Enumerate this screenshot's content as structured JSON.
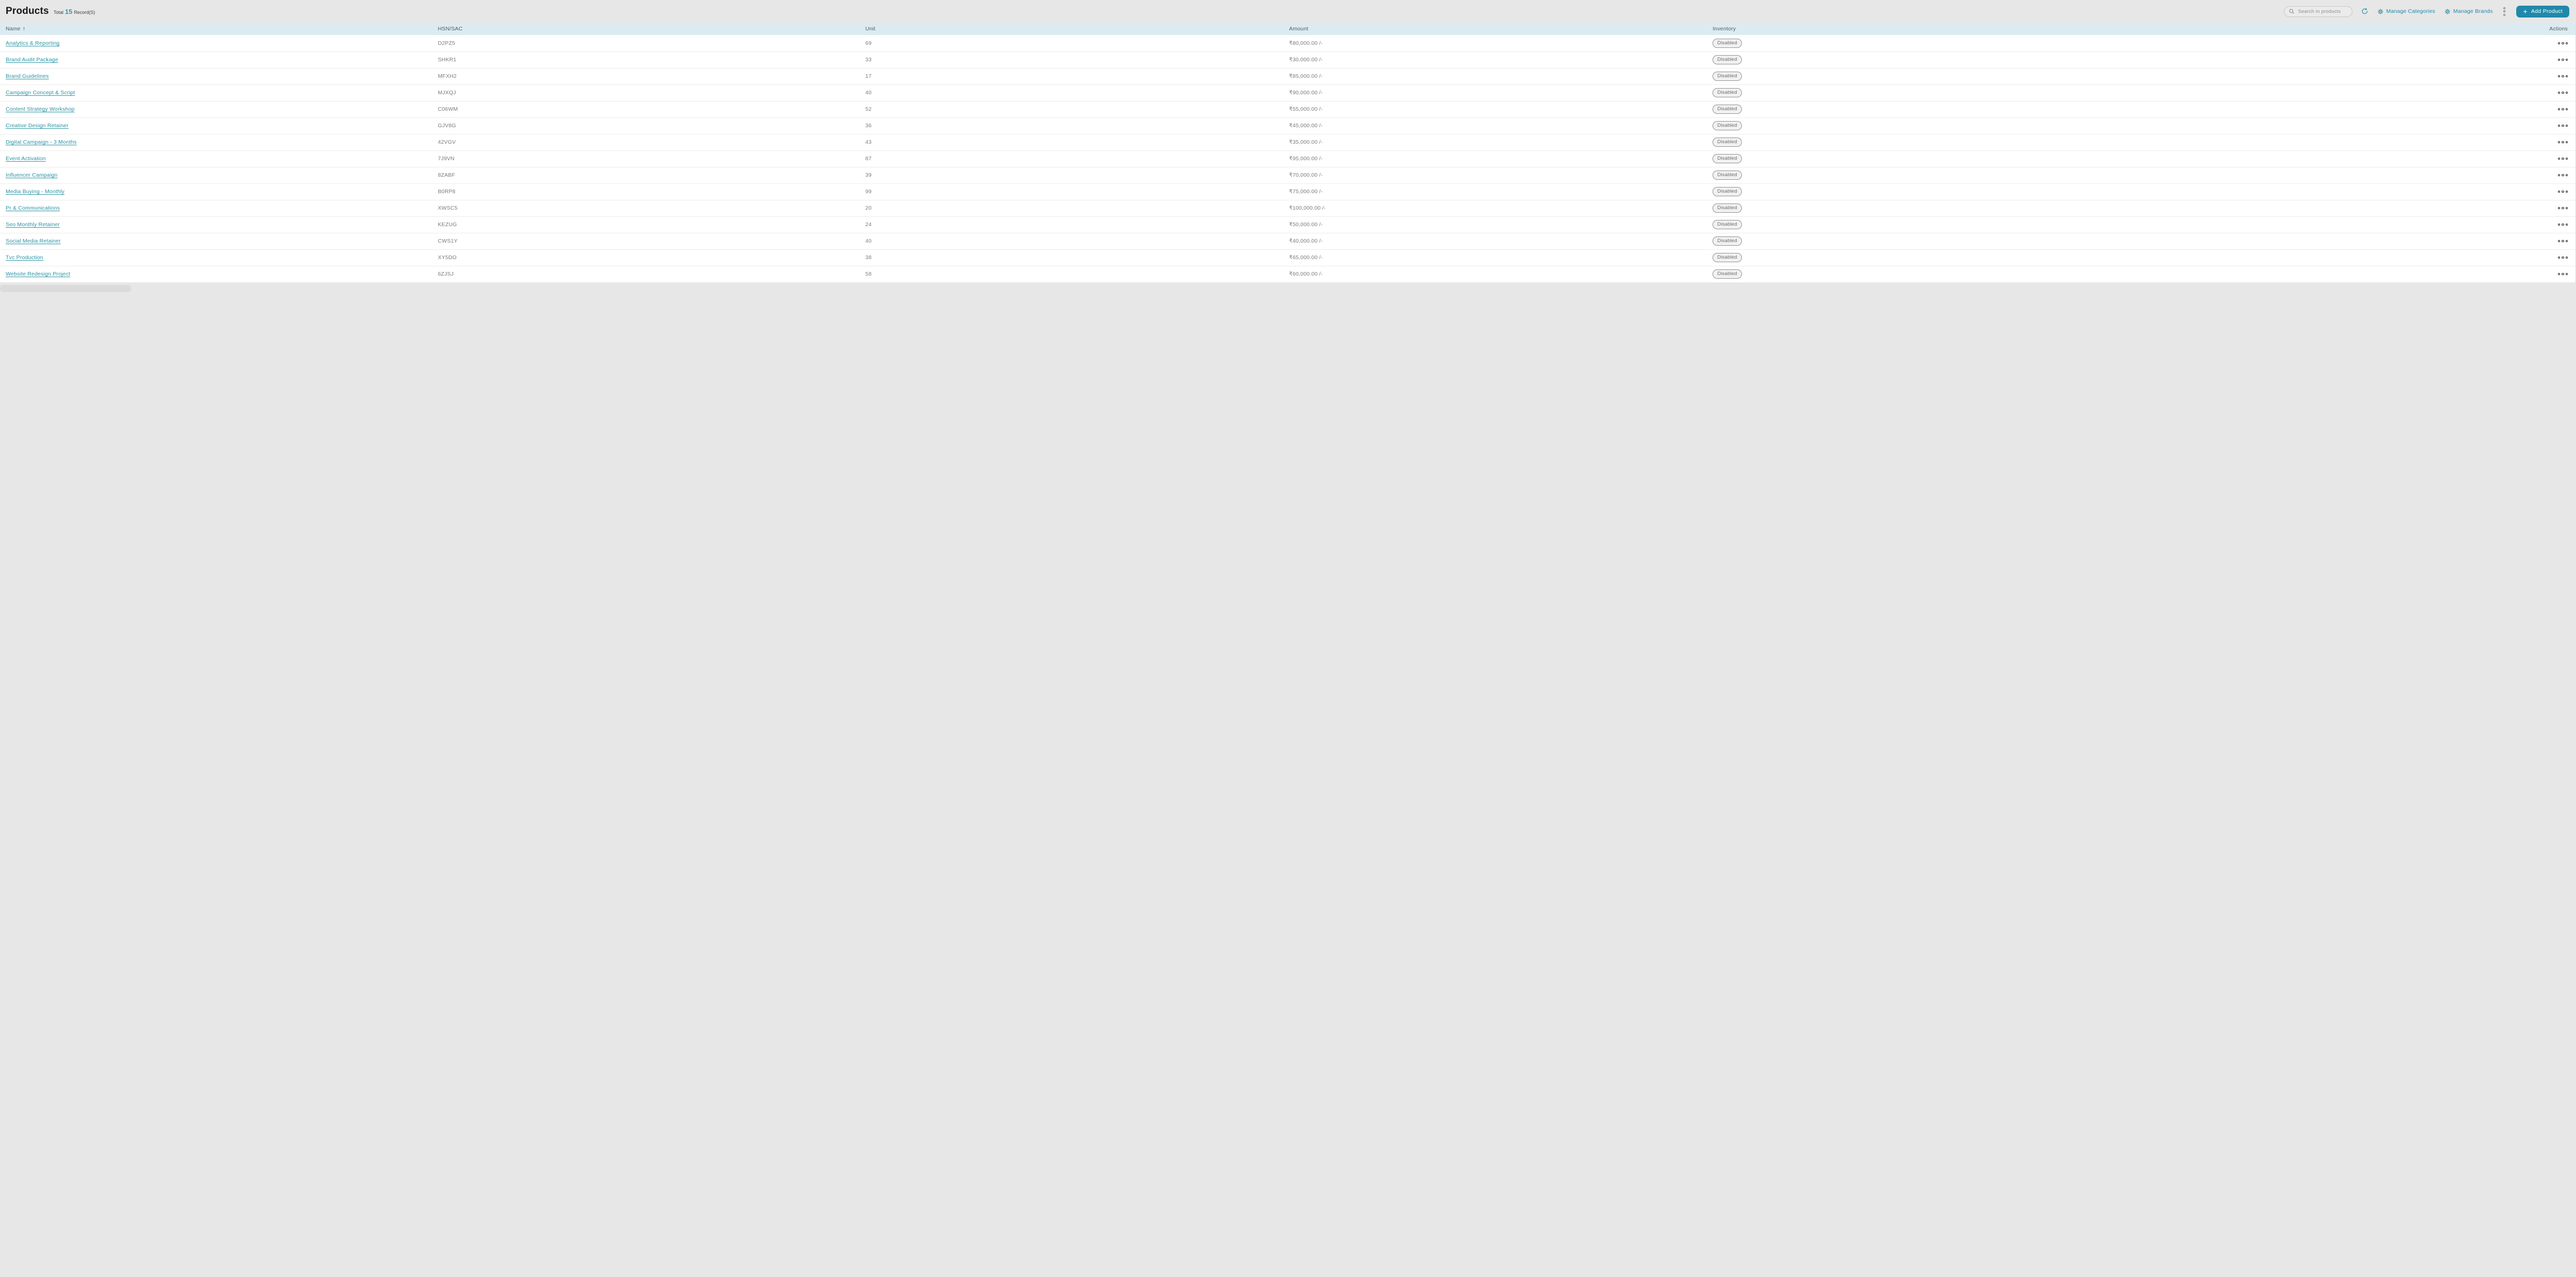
{
  "header": {
    "title": "Products",
    "total_label": "Total",
    "total_count": "15",
    "records_label": "Record(S)",
    "search": {
      "placeholder": "Search in products",
      "icon": "search-icon"
    },
    "toolbar": {
      "refresh_icon": "refresh-icon",
      "manage_categories_label": "Manage Categories",
      "manage_brands_label": "Manage Brands",
      "gear_icon": "gear-icon",
      "more_icon": "kebab-menu-icon",
      "plus_glyph": "+",
      "add_product_label": "Add Product"
    }
  },
  "colors": {
    "page_bg": "#e7e7e7",
    "accent_teal": "#2089aa",
    "link_teal": "#2792a2",
    "count_blue": "#2b9ac2",
    "table_header_bg": "#dcebf2",
    "badge_bg": "#f1f1f1",
    "badge_border": "#909090"
  },
  "table": {
    "columns": [
      "Name",
      "HSN/SAC",
      "Unit",
      "Amount",
      "Inventory",
      "Actions"
    ],
    "sort": {
      "column": "Name",
      "direction": "ascending",
      "glyph": "↑",
      "icon": "sort-ascending-icon"
    },
    "row_actions_icon": "ellipsis-icon",
    "rows": [
      {
        "name": "Analytics & Reporting",
        "hsn_sac": "D2PZ5",
        "unit": "69",
        "amount": "₹80,000.00 /-",
        "inventory": "Disabled"
      },
      {
        "name": "Brand Audit Package",
        "hsn_sac": "SHKR1",
        "unit": "33",
        "amount": "₹30,000.00 /-",
        "inventory": "Disabled"
      },
      {
        "name": "Brand Guidelines",
        "hsn_sac": "MFXH2",
        "unit": "17",
        "amount": "₹85,000.00 /-",
        "inventory": "Disabled"
      },
      {
        "name": "Campaign Concept & Script",
        "hsn_sac": "MJXQJ",
        "unit": "40",
        "amount": "₹90,000.00 /-",
        "inventory": "Disabled"
      },
      {
        "name": "Content Strategy Workshop",
        "hsn_sac": "C06WM",
        "unit": "52",
        "amount": "₹55,000.00 /-",
        "inventory": "Disabled"
      },
      {
        "name": "Creative Design Retainer",
        "hsn_sac": "GJV8G",
        "unit": "36",
        "amount": "₹45,000.00 /-",
        "inventory": "Disabled"
      },
      {
        "name": "Digital Campaign - 3 Months",
        "hsn_sac": "42VGV",
        "unit": "43",
        "amount": "₹35,000.00 /-",
        "inventory": "Disabled"
      },
      {
        "name": "Event Activation",
        "hsn_sac": "7J9VN",
        "unit": "87",
        "amount": "₹95,000.00 /-",
        "inventory": "Disabled"
      },
      {
        "name": "Influencer Campaign",
        "hsn_sac": "8ZABF",
        "unit": "39",
        "amount": "₹70,000.00 /-",
        "inventory": "Disabled"
      },
      {
        "name": "Media Buying - Monthly",
        "hsn_sac": "B0RP8",
        "unit": "99",
        "amount": "₹75,000.00 /-",
        "inventory": "Disabled"
      },
      {
        "name": "Pr & Communications",
        "hsn_sac": "XWSC5",
        "unit": "20",
        "amount": "₹100,000.00 /-",
        "inventory": "Disabled"
      },
      {
        "name": "Seo Monthly Retainer",
        "hsn_sac": "KEZUG",
        "unit": "24",
        "amount": "₹50,000.00 /-",
        "inventory": "Disabled"
      },
      {
        "name": "Social Media Retainer",
        "hsn_sac": "CWS1Y",
        "unit": "40",
        "amount": "₹40,000.00 /-",
        "inventory": "Disabled"
      },
      {
        "name": "Tvc Production",
        "hsn_sac": "XY5DO",
        "unit": "38",
        "amount": "₹65,000.00 /-",
        "inventory": "Disabled"
      },
      {
        "name": "Website Redesign Project",
        "hsn_sac": "6ZJSJ",
        "unit": "58",
        "amount": "₹60,000.00 /-",
        "inventory": "Disabled"
      }
    ]
  }
}
